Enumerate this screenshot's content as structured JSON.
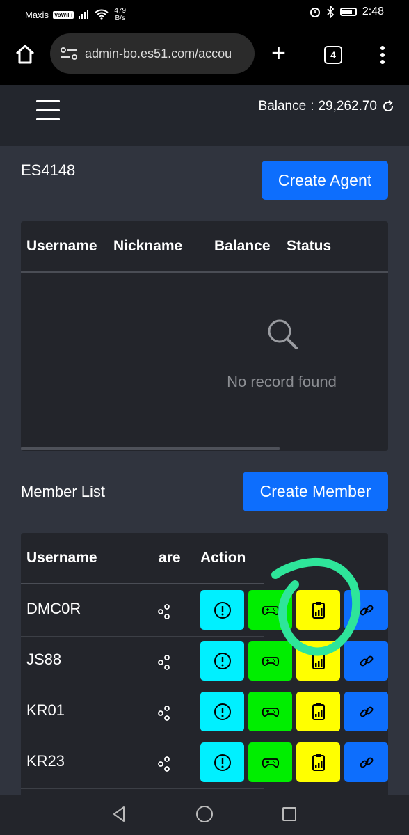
{
  "status_bar": {
    "carrier": "Maxis",
    "wifi_badge": "VoWiFi",
    "speed_value": "479",
    "speed_unit": "B/s",
    "time": "2:48",
    "icons": [
      "signal-icon",
      "wifi-icon",
      "alarm-icon",
      "bluetooth-icon",
      "battery-icon"
    ]
  },
  "browser": {
    "url": "admin-bo.es51.com/accou",
    "tab_count": "4",
    "new_tab_label": "+"
  },
  "header": {
    "balance_label": "Balance",
    "balance_separator": ":",
    "balance_value": "29,262.70"
  },
  "agent_section": {
    "title": "ES4148",
    "create_button": "Create Agent",
    "columns": [
      "Username",
      "Nickname",
      "Balance",
      "Status"
    ],
    "empty_text": "No record found"
  },
  "member_section": {
    "title": "Member List",
    "create_button": "Create Member",
    "columns": [
      "Username",
      "are",
      "Action"
    ],
    "rows": [
      {
        "username": "DMC0R"
      },
      {
        "username": "JS88"
      },
      {
        "username": "KR01"
      },
      {
        "username": "KR23"
      }
    ],
    "action_buttons": [
      "info",
      "game",
      "report",
      "link"
    ]
  },
  "colors": {
    "page_bg": "#30343e",
    "header_bg": "#23262d",
    "table_bg": "#23252b",
    "primary": "#0d6efd",
    "info_btn": "#00f0ff",
    "game_btn": "#00ee00",
    "report_btn": "#ffff00",
    "annotation": "#2ee59a"
  }
}
